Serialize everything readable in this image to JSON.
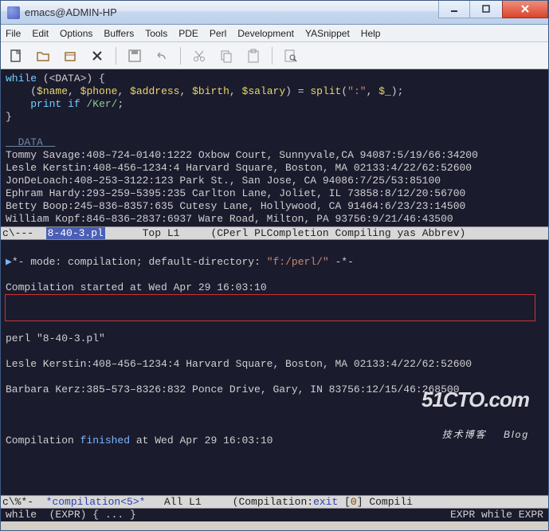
{
  "window": {
    "title": "emacs@ADMIN-HP"
  },
  "menu": {
    "items": [
      "File",
      "Edit",
      "Options",
      "Buffers",
      "Tools",
      "PDE",
      "Perl",
      "Development",
      "YASnippet",
      "Help"
    ]
  },
  "toolbar": {
    "icons": [
      "new-file-icon",
      "open-folder-icon",
      "open-dir-icon",
      "kill-buffer-icon",
      "save-icon",
      "undo-icon",
      "cut-icon",
      "copy-icon",
      "paste-icon",
      "search-icon"
    ]
  },
  "editor": {
    "code_html": "<span class='kw'>while</span> (&lt;DATA&gt;) {\n    (<span class='fn'>$name</span>, <span class='fn'>$phone</span>, <span class='fn'>$address</span>, <span class='fn'>$birth</span>, <span class='fn'>$salary</span>) = <span class='fn'>split</span>(<span class='str'>\":\"</span>, <span class='fn'>$_</span>);\n    <span class='kw'>print</span> <span class='kw'>if</span> <span class='re'>/Ker/</span>;\n}\n\n<span class='comment'>__DATA__</span>\nTommy Savage:408–724–0140:1222 Oxbow Court, Sunnyvale,CA 94087:5/19/66:34200\nLesle Kerstin:408–456–1234:4 Harvard Square, Boston, MA 02133:4/22/62:52600\nJonDeLoach:408–253–3122:123 Park St., San Jose, CA 94086:7/25/53:85100\nEphram Hardy:293–259–5395:235 Carlton Lane, Joliet, IL 73858:8/12/20:56700\nBetty Boop:245–836–8357:635 Cutesy Lane, Hollywood, CA 91464:6/23/23:14500\nWilliam Kopf:846–836–2837:6937 Ware Road, Milton, PA 93756:9/21/46:43500"
  },
  "modeline1": {
    "left": "c\\---  ",
    "buffer": "8-40-3.pl",
    "pos": "      Top L1    ",
    "mode": " (CPerl PLCompletion Compiling yas Abbrev)"
  },
  "compilation": {
    "line1_html": "<span style='color:#7bb6ff'>▶</span>*- mode: compilation; default-directory: <span class='str'>\"f:/perl/\"</span> -*-",
    "line2": "Compilation started at Wed Apr 29 16:03:10",
    "cmd": "perl \"8-40-3.pl\"",
    "out1": "Lesle Kerstin:408–456–1234:4 Harvard Square, Boston, MA 02133:4/22/62:52600",
    "out2": "Barbara Kerz:385–573–8326:832 Ponce Drive, Gary, IN 83756:12/15/46:268500",
    "finish_html": "Compilation <span class='link'>finished</span> at Wed Apr 29 16:03:10"
  },
  "modeline2": {
    "text_html": "c\\%*-  <span class='bufname'>*compilation&lt;5&gt;*</span>   All L1     (Compilation:<span class='exit'>exit</span> [<span class='num'>0</span>] Compili"
  },
  "minibuf": {
    "left": "while  (EXPR) { ... }",
    "right": "EXPR while EXPR"
  },
  "watermark": {
    "big": "51CTO.com",
    "small": "技术博客    Blog"
  }
}
